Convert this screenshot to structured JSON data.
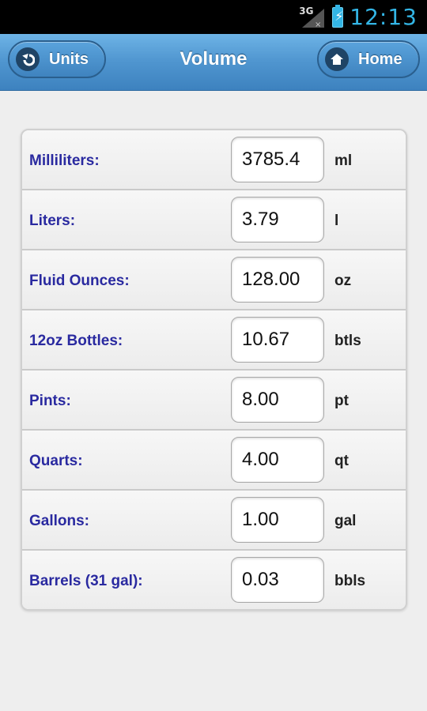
{
  "status_bar": {
    "network_label": "3G",
    "clock": "12:13",
    "accent": "#33b5e5"
  },
  "header": {
    "title": "Volume",
    "back_label": "Units",
    "home_label": "Home",
    "back_icon": "back-arrow-icon",
    "home_icon": "home-icon"
  },
  "conversions": [
    {
      "label": "Milliliters:",
      "value": "3785.4",
      "unit": "ml"
    },
    {
      "label": "Liters:",
      "value": "3.79",
      "unit": "l"
    },
    {
      "label": "Fluid Ounces:",
      "value": "128.00",
      "unit": "oz"
    },
    {
      "label": "12oz Bottles:",
      "value": "10.67",
      "unit": "btls"
    },
    {
      "label": "Pints:",
      "value": "8.00",
      "unit": "pt"
    },
    {
      "label": "Quarts:",
      "value": "4.00",
      "unit": "qt"
    },
    {
      "label": "Gallons:",
      "value": "1.00",
      "unit": "gal"
    },
    {
      "label": "Barrels (31 gal):",
      "value": "0.03",
      "unit": "bbls"
    }
  ]
}
